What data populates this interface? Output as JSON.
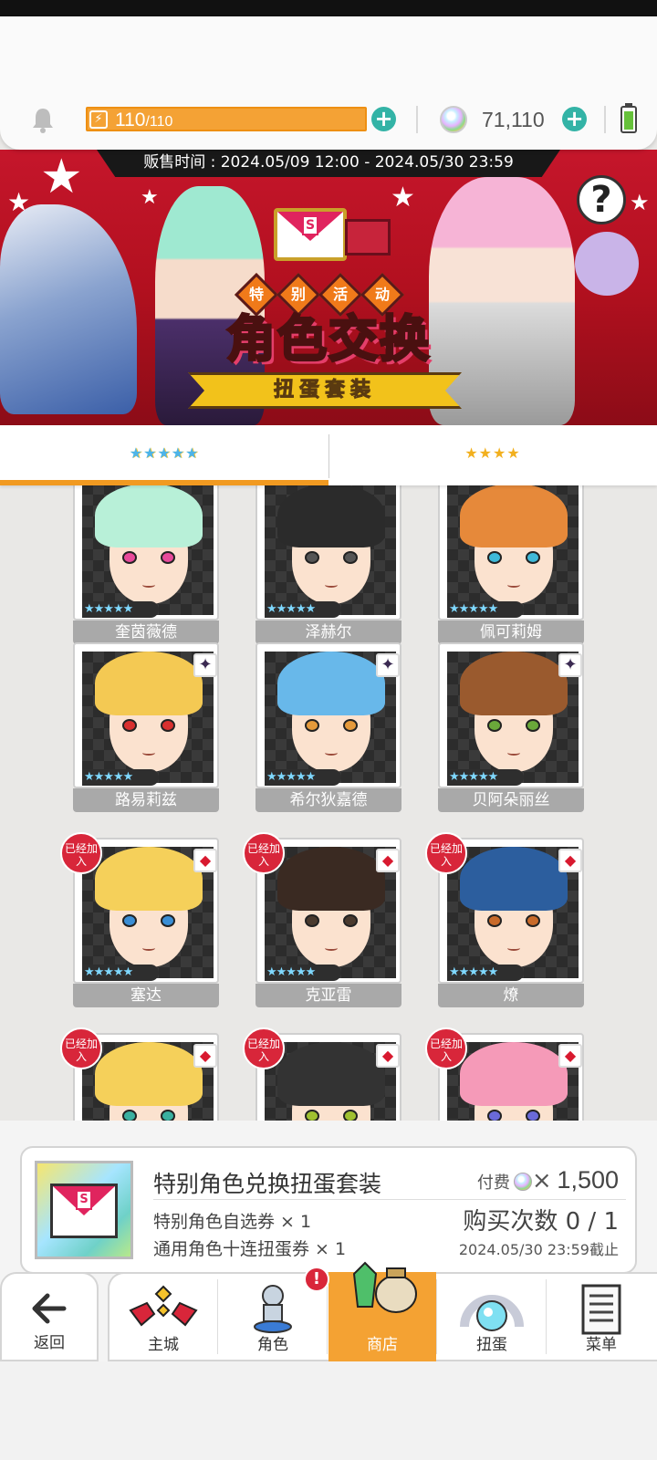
{
  "header": {
    "energy_current": "110",
    "energy_max": "/110",
    "gems": "71,110"
  },
  "banner": {
    "sale_time": "贩售时间 : 2024.05/09 12:00 - 2024.05/30 23:59",
    "subtitle_chars": [
      "特",
      "别",
      "活",
      "动"
    ],
    "title": "角色交换",
    "ribbon": "扭蛋套装",
    "help": "?"
  },
  "tabs": [
    {
      "label": "★★★★★",
      "selected": true
    },
    {
      "label": "★★★★",
      "selected": false
    }
  ],
  "characters": [
    {
      "name": "奎茵薇德",
      "stars": "★★★★★",
      "tag": "",
      "joined": false,
      "hair": "#b8f0d8",
      "eye": "#e84a9b"
    },
    {
      "name": "泽赫尔",
      "stars": "★★★★★",
      "tag": "",
      "joined": false,
      "hair": "#2b2b2b",
      "eye": "#555555"
    },
    {
      "name": "佩可莉姆",
      "stars": "★★★★★",
      "tag": "",
      "joined": false,
      "hair": "#e6893a",
      "eye": "#3fb9d8"
    },
    {
      "name": "路易莉兹",
      "stars": "★★★★★",
      "tag": "✦",
      "joined": false,
      "hair": "#f4c953",
      "eye": "#d8302f"
    },
    {
      "name": "希尔狄嘉德",
      "stars": "★★★★★",
      "tag": "✦",
      "joined": false,
      "hair": "#68b8ea",
      "eye": "#e59a3b"
    },
    {
      "name": "贝阿朵丽丝",
      "stars": "★★★★★",
      "tag": "✦",
      "joined": false,
      "hair": "#9a5a2e",
      "eye": "#6aa83a"
    },
    {
      "name": "塞达",
      "stars": "★★★★★",
      "tag": "◆",
      "joined": true,
      "hair": "#f5d05a",
      "eye": "#3a8ed5"
    },
    {
      "name": "克亚雷",
      "stars": "★★★★★",
      "tag": "◆",
      "joined": true,
      "hair": "#3a2a22",
      "eye": "#4a3a2e"
    },
    {
      "name": "燎",
      "stars": "★★★★★",
      "tag": "◆",
      "joined": true,
      "hair": "#2c5e9e",
      "eye": "#c86a2a"
    },
    {
      "name": "",
      "stars": "",
      "tag": "◆",
      "joined": true,
      "hair": "#f5d05a",
      "eye": "#3ab0a0"
    },
    {
      "name": "",
      "stars": "",
      "tag": "◆",
      "joined": true,
      "hair": "#333333",
      "eye": "#a0c030"
    },
    {
      "name": "",
      "stars": "",
      "tag": "◆",
      "joined": true,
      "hair": "#f59ab8",
      "eye": "#6a6ad8"
    }
  ],
  "joined_label": "已经加入",
  "pack": {
    "title": "特别角色兑换扭蛋套装",
    "price_label": "付费",
    "price_times": "×",
    "price_amount": "1,500",
    "item1": "特别角色自选券 × 1",
    "item2": "通用角色十连扭蛋券 × 1",
    "buy_count": "购买次数 0 / 1",
    "deadline": "2024.05/30 23:59截止"
  },
  "nav": {
    "back": "返回",
    "items": [
      "主城",
      "角色",
      "商店",
      "扭蛋",
      "菜单"
    ],
    "active_index": 2,
    "badge": "!"
  }
}
